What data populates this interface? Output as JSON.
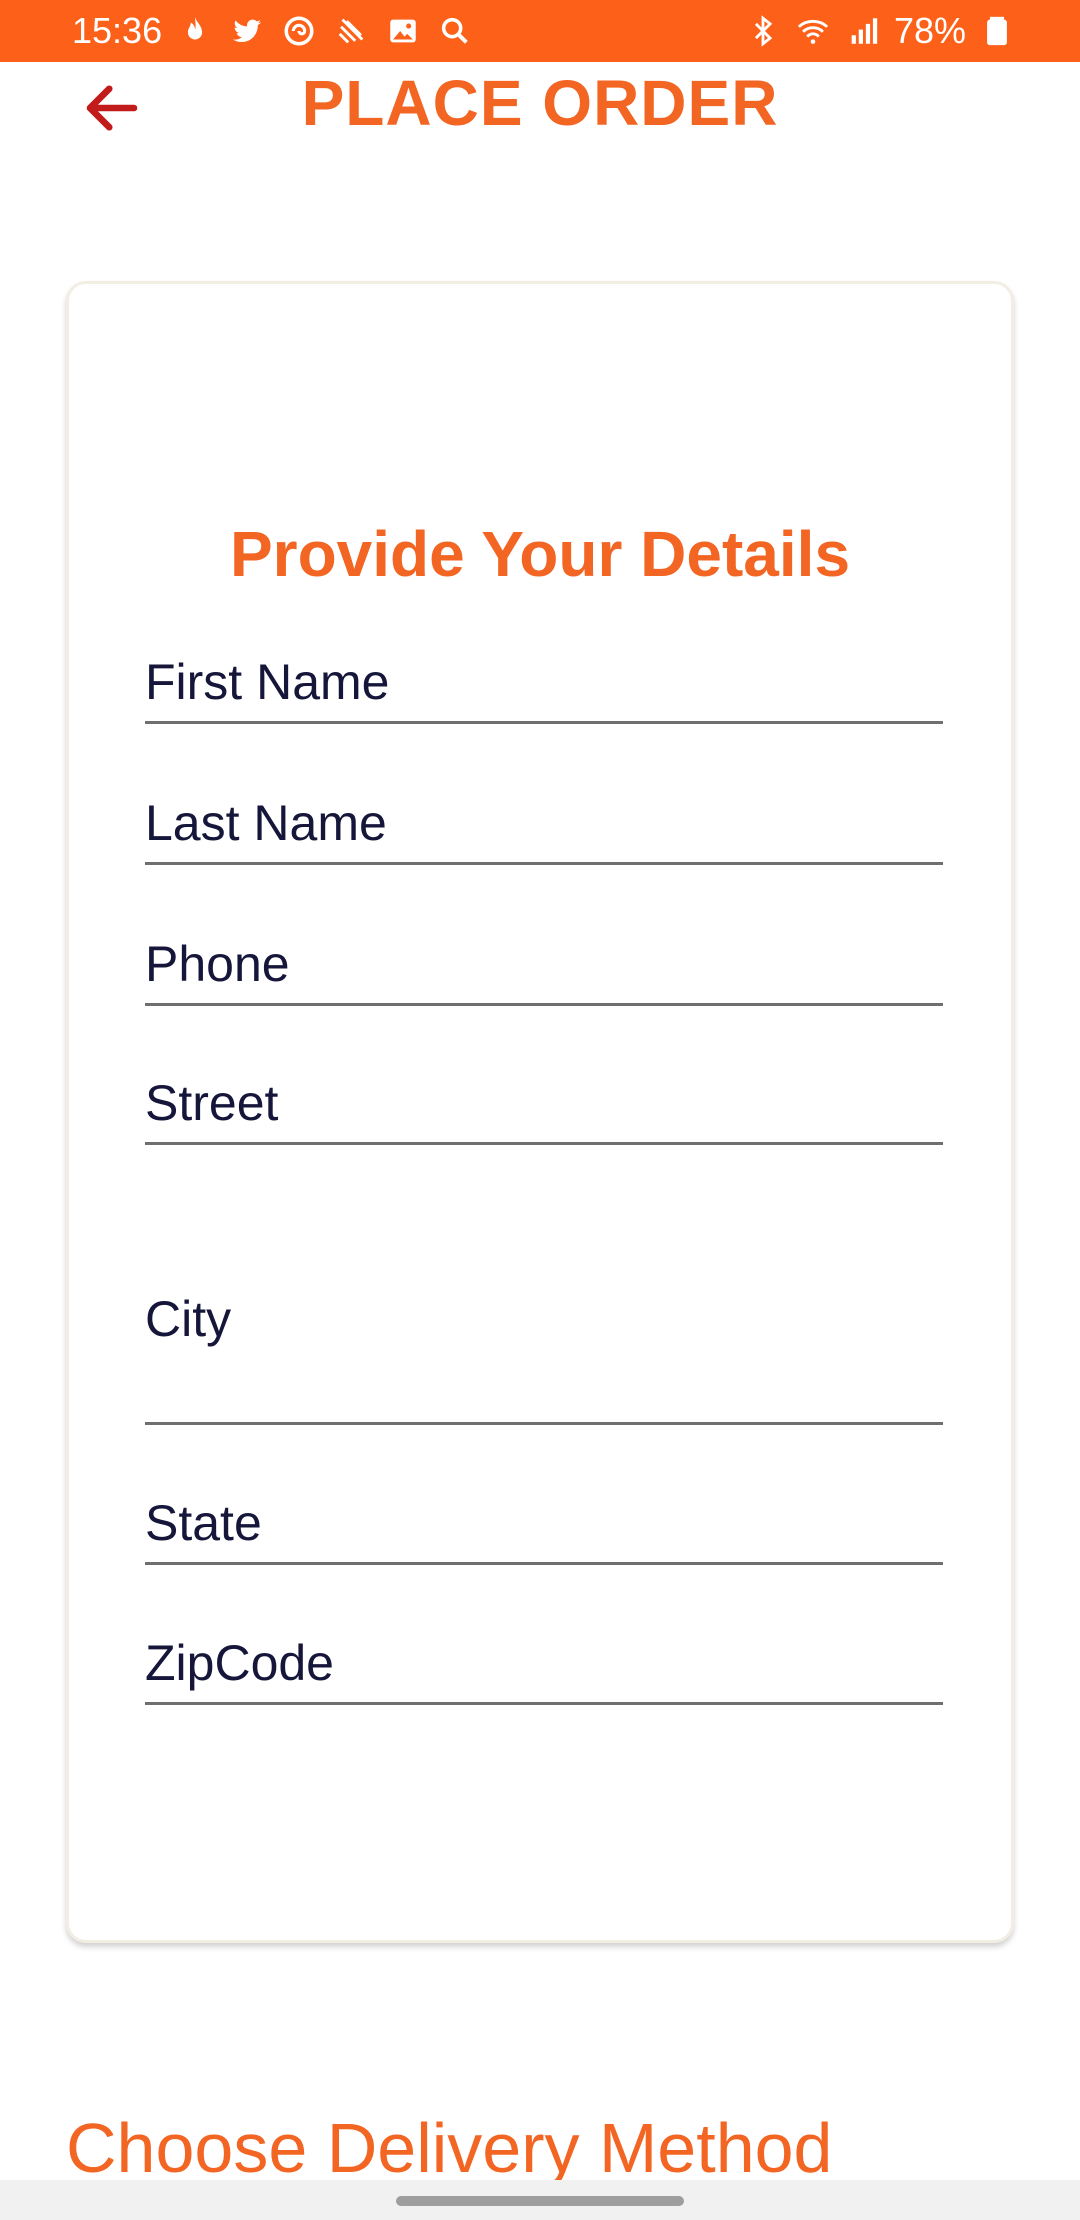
{
  "status_bar": {
    "time": "15:36",
    "battery": "78%",
    "background": "#fd6119",
    "left_icons": [
      "flame-icon",
      "twitter-icon",
      "swirl-app-icon",
      "no-disturb-icon",
      "image-icon",
      "search-icon"
    ],
    "right_icons": [
      "bluetooth-icon",
      "wifi-icon",
      "signal-icon",
      "battery-icon"
    ]
  },
  "header": {
    "title": "PLACE ORDER",
    "back_icon": "back-arrow-icon",
    "title_color": "#f26522",
    "back_icon_color": "#c21b1b"
  },
  "details_card": {
    "title": "Provide Your Details",
    "fields": [
      {
        "key": "first_name",
        "label": "First Name"
      },
      {
        "key": "last_name",
        "label": "Last Name"
      },
      {
        "key": "phone",
        "label": "Phone"
      },
      {
        "key": "street",
        "label": "Street"
      },
      {
        "key": "city",
        "label": "City"
      },
      {
        "key": "state",
        "label": "State"
      },
      {
        "key": "zipcode",
        "label": "ZipCode"
      }
    ]
  },
  "delivery_section": {
    "title": "Choose Delivery Method"
  },
  "colors": {
    "accent": "#f26522",
    "label_text": "#15163a",
    "underline": "#6f6f6f"
  }
}
